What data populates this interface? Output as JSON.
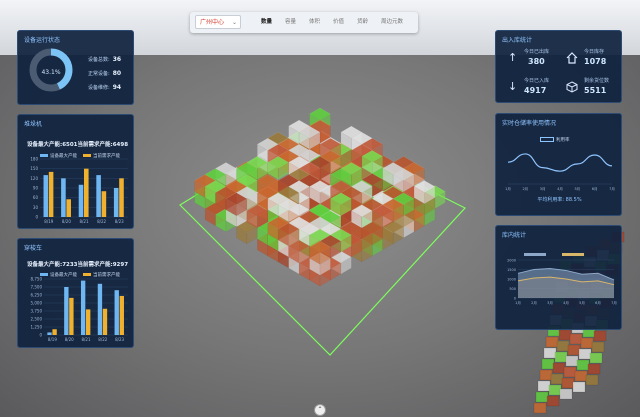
{
  "topbar": {
    "location": "广州中心",
    "tabs": [
      "数量",
      "容量",
      "体积",
      "价值",
      "货龄",
      "周边元数"
    ],
    "active_tab": 0
  },
  "device_status": {
    "title": "设备运行状态",
    "percent": "43.1%",
    "percent_fraction": 0.431,
    "total_label": "设备总数:",
    "total_value": "36",
    "normal_label": "正常设备:",
    "normal_value": "80",
    "repair_label": "设备维修:",
    "repair_value": "94"
  },
  "stacker": {
    "title": "堆垛机",
    "subtitle": "设备最大产能:6501当前需求产能:6498",
    "legend": [
      "设备最大产能",
      "当前需求产能"
    ],
    "chart_data": {
      "type": "bar",
      "categories": [
        "8/19",
        "8/20",
        "8/21",
        "8/22",
        "8/23"
      ],
      "ylim": [
        0,
        180
      ],
      "yticks": [
        "0",
        "30",
        "60",
        "90",
        "120",
        "150",
        "180"
      ],
      "series": [
        {
          "name": "设备最大产能",
          "values": [
            130,
            120,
            100,
            130,
            90
          ],
          "color": "#6fb7f3"
        },
        {
          "name": "当前需求产能",
          "values": [
            140,
            55,
            150,
            80,
            120
          ],
          "color": "#f0b12e"
        }
      ]
    }
  },
  "shuttle": {
    "title": "穿梭车",
    "subtitle": "设备最大产能:7233当前需求产能:9297",
    "legend": [
      "设备最大产能",
      "当前需求产能"
    ],
    "chart_data": {
      "type": "bar",
      "categories": [
        "8/19",
        "8/20",
        "8/21",
        "8/22",
        "8/23"
      ],
      "ylim": [
        0,
        8750
      ],
      "yticks": [
        "0",
        "1,250",
        "2,500",
        "3,750",
        "5,000",
        "6,250",
        "7,500",
        "8,750"
      ],
      "series": [
        {
          "name": "设备最大产能",
          "values": [
            400,
            7500,
            8500,
            8000,
            7000
          ],
          "color": "#6fb7f3"
        },
        {
          "name": "当前需求产能",
          "values": [
            900,
            5800,
            4000,
            4100,
            6100
          ],
          "color": "#f0b12e"
        }
      ]
    }
  },
  "inout": {
    "title": "出入库统计",
    "items": [
      {
        "icon": "arrow-up-icon",
        "label": "今日已出库",
        "value": "380"
      },
      {
        "icon": "home-icon",
        "label": "今日库存",
        "value": "1078"
      },
      {
        "icon": "arrow-down-icon",
        "label": "今日已入库",
        "value": "4917"
      },
      {
        "icon": "box-icon",
        "label": "剩余货位数",
        "value": "5511"
      }
    ]
  },
  "usage": {
    "title": "实时仓储率使用情况",
    "legend": "利用率",
    "caption": "平均利用率: 88.5%",
    "chart_data": {
      "type": "line",
      "x": [
        "1月",
        "2月",
        "3月",
        "4月",
        "5月",
        "6月",
        "7月"
      ],
      "series": [
        {
          "name": "利用率",
          "values": [
            55,
            78,
            40,
            30,
            50,
            75,
            45
          ]
        }
      ]
    }
  },
  "stock": {
    "title": "库内统计",
    "legend": [
      "",
      ""
    ],
    "chart_data": {
      "type": "area",
      "x": [
        "1月",
        "2月",
        "3月",
        "4月",
        "5月",
        "6月",
        "7月"
      ],
      "yticks": [
        "0",
        "500",
        "1000",
        "1500",
        "2000"
      ],
      "series": [
        {
          "values": [
            1300,
            1500,
            1550,
            1450,
            1250,
            1300,
            950
          ]
        },
        {
          "values": [
            900,
            1050,
            1100,
            1000,
            850,
            900,
            700
          ]
        }
      ]
    }
  },
  "scroll_icon": "chevron-up-icon"
}
